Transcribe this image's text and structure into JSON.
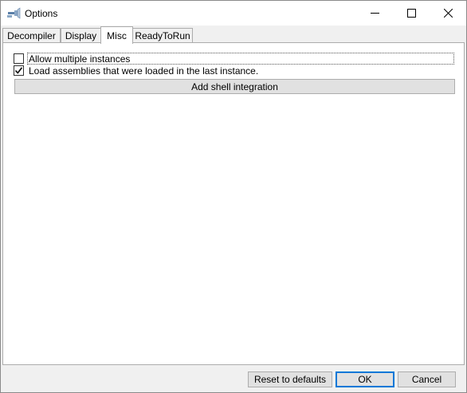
{
  "window": {
    "title": "Options",
    "controls": {
      "minimize": "—",
      "maximize": "☐",
      "close": "✕"
    }
  },
  "tabs": [
    {
      "label": "Decompiler",
      "selected": false
    },
    {
      "label": "Display",
      "selected": false
    },
    {
      "label": "Misc",
      "selected": true
    },
    {
      "label": "ReadyToRun",
      "selected": false
    }
  ],
  "misc": {
    "allow_multiple_instances": {
      "label": "Allow multiple instances",
      "checked": false
    },
    "load_assemblies": {
      "label": "Load assemblies that were loaded in the last instance.",
      "checked": true
    },
    "shell_integration_button": "Add shell integration"
  },
  "footer": {
    "reset_label": "Reset to defaults",
    "ok_label": "OK",
    "cancel_label": "Cancel"
  },
  "colors": {
    "accent": "#0078d7"
  }
}
